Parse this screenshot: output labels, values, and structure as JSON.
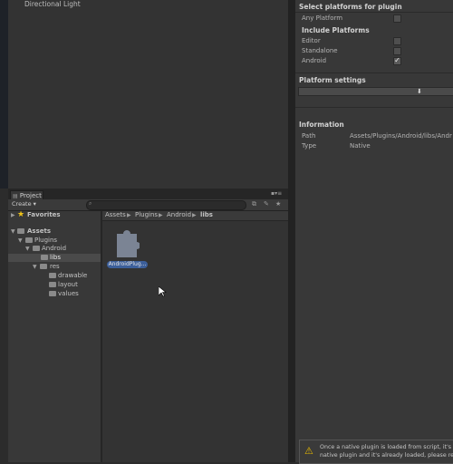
{
  "hierarchy": {
    "item": "Directional Light"
  },
  "inspector": {
    "select_platforms_header": "Select platforms for plugin",
    "any_platform_label": "Any Platform",
    "include_platforms_header": "Include Platforms",
    "platforms": [
      {
        "label": "Editor",
        "checked": false
      },
      {
        "label": "Standalone",
        "checked": false
      },
      {
        "label": "Android",
        "checked": true
      }
    ],
    "platform_settings_header": "Platform settings",
    "information_header": "Information",
    "path_label": "Path",
    "path_value": "Assets/Plugins/Android/libs/Andr",
    "type_label": "Type",
    "type_value": "Native",
    "warning_line1": "Once a native plugin is loaded from script, it's ne",
    "warning_line2": "native plugin and it's already loaded, please resta"
  },
  "project": {
    "tab_label": "Project",
    "create_label": "Create ▾",
    "favorites_label": "Favorites",
    "breadcrumb": [
      "Assets",
      "Plugins",
      "Android",
      "libs"
    ],
    "tree": [
      {
        "label": "Assets"
      },
      {
        "label": "Plugins"
      },
      {
        "label": "Android"
      },
      {
        "label": "libs"
      },
      {
        "label": "res"
      },
      {
        "label": "drawable"
      },
      {
        "label": "layout"
      },
      {
        "label": "values"
      }
    ],
    "file_name": "AndroidPlug..."
  },
  "icons": [
    "star-icon",
    "folder-icon",
    "puzzle-plugin-icon",
    "warning-icon",
    "search-icon",
    "lock-icon",
    "cursor-icon"
  ]
}
